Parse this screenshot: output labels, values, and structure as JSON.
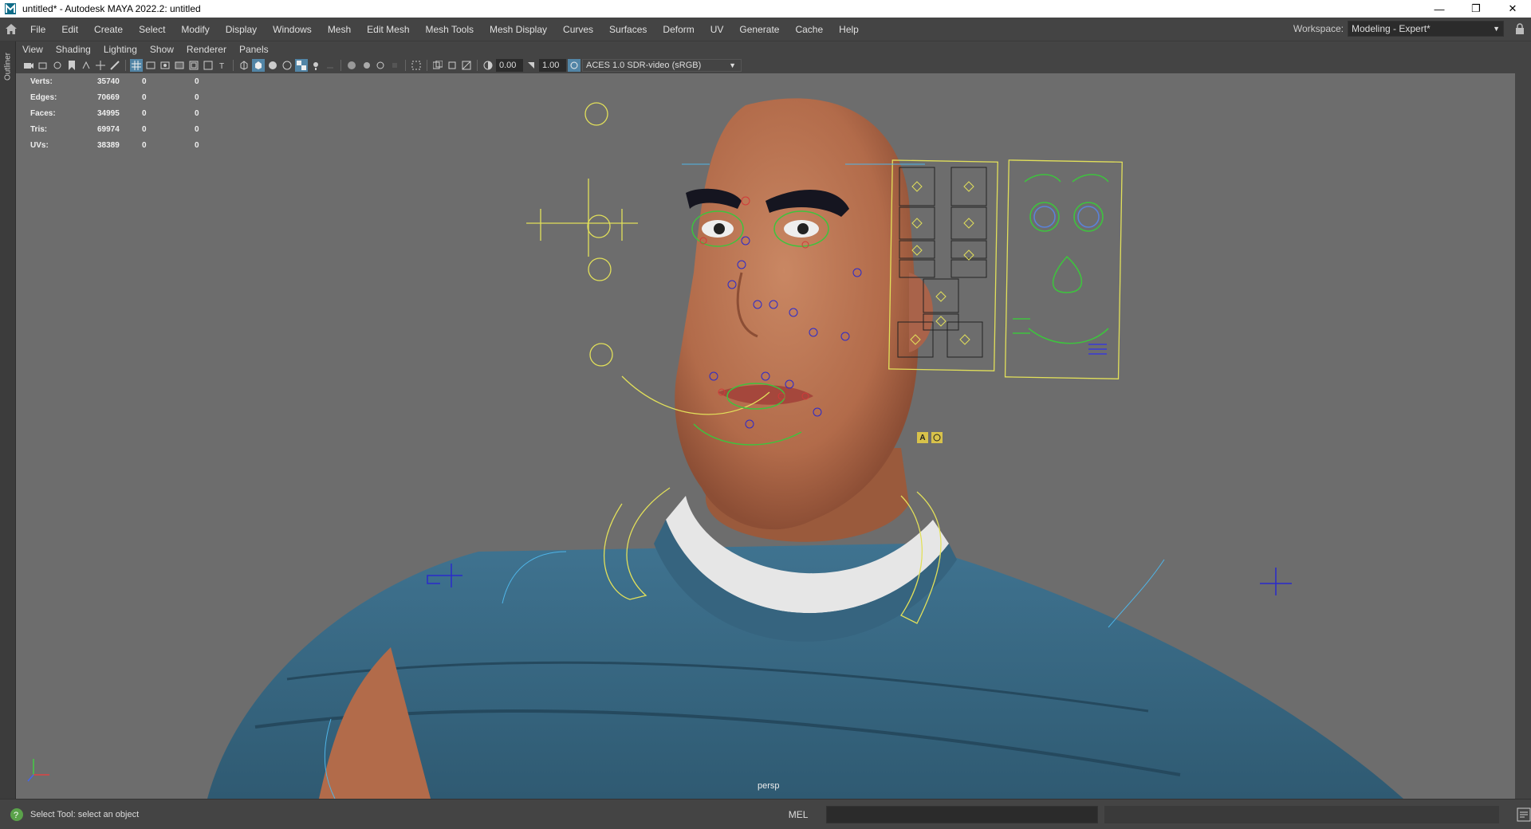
{
  "window": {
    "title": "untitled* - Autodesk MAYA 2022.2: untitled",
    "controls": [
      "minimize-icon",
      "restore-icon",
      "close-icon"
    ]
  },
  "menubar": {
    "items": [
      "File",
      "Edit",
      "Create",
      "Select",
      "Modify",
      "Display",
      "Windows",
      "Mesh",
      "Edit Mesh",
      "Mesh Tools",
      "Mesh Display",
      "Curves",
      "Surfaces",
      "Deform",
      "UV",
      "Generate",
      "Cache",
      "Help"
    ],
    "workspace_label": "Workspace:",
    "workspace_value": "Modeling - Expert*"
  },
  "sidebar": {
    "outliner_label": "Outliner"
  },
  "panel_menu": [
    "View",
    "Shading",
    "Lighting",
    "Show",
    "Renderer",
    "Panels"
  ],
  "toolbar": {
    "exposure": "0.00",
    "gamma": "1.00",
    "color_management": "ACES 1.0 SDR-video (sRGB)"
  },
  "hud": {
    "rows": [
      {
        "label": "Verts:",
        "value": "35740",
        "sel": "0",
        "comp": "0"
      },
      {
        "label": "Edges:",
        "value": "70669",
        "sel": "0",
        "comp": "0"
      },
      {
        "label": "Faces:",
        "value": "34995",
        "sel": "0",
        "comp": "0"
      },
      {
        "label": "Tris:",
        "value": "69974",
        "sel": "0",
        "comp": "0"
      },
      {
        "label": "UVs:",
        "value": "38389",
        "sel": "0",
        "comp": "0"
      }
    ]
  },
  "viewport": {
    "camera": "persp",
    "background": "#6d6d6d"
  },
  "facepanel": {
    "btn_a": "A"
  },
  "statusbar": {
    "message": "Select Tool: select an object",
    "mel_label": "MEL"
  }
}
